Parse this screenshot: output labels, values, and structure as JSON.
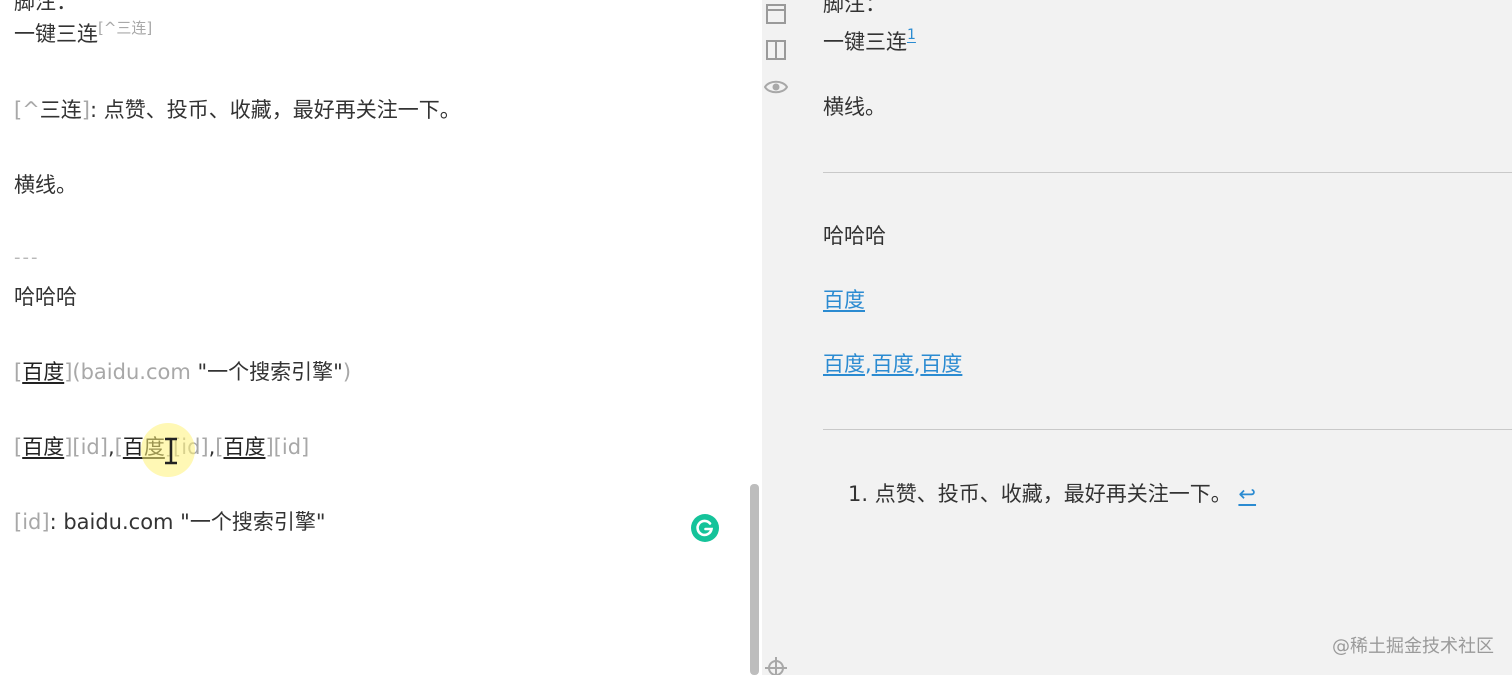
{
  "editor": {
    "line0": "脚注：",
    "line1_text": "一键三连",
    "line1_footnote_ref": "[^三连]",
    "footnote_def": {
      "label_open": "[^",
      "label": "三连",
      "label_close": "]",
      "text": ": 点赞、投币、收藏，最好再关注一下。"
    },
    "hengxian": "横线。",
    "hr_syntax": "---",
    "hahaha": "哈哈哈",
    "inline_link": {
      "open": "[",
      "text": "百度",
      "close": "]",
      "url_part": "(baidu.com ",
      "title": "\"一个搜索引擎\"",
      "end": ")"
    },
    "ref_links": {
      "open": "[",
      "text": "百度",
      "ref": "][id]",
      "comma": ","
    },
    "ref_def": {
      "label": "[id]",
      "rest": ": baidu.com \"一个搜索引擎\""
    },
    "grammarly_glyph": "G"
  },
  "preview": {
    "line0": "脚注：",
    "line1_text": "一键三连",
    "footnote_sup": "1",
    "hengxian": "横线。",
    "hahaha": "哈哈哈",
    "link_baidu": "百度",
    "comma": ",",
    "footnote_number": "1.",
    "footnote_text": "点赞、投币、收藏，最好再关注一下。",
    "backref": "↩"
  },
  "toolbar": {
    "icons": [
      "window-icon",
      "split-view-icon",
      "preview-eye-icon",
      "sync-scroll-icon"
    ]
  },
  "watermark": "@稀土掘金技术社区",
  "colors": {
    "link": "#2b8bd1",
    "preview_bg": "#f2f2f2",
    "grammarly": "#15c39a",
    "syntax_gray": "#a8a8a8"
  }
}
